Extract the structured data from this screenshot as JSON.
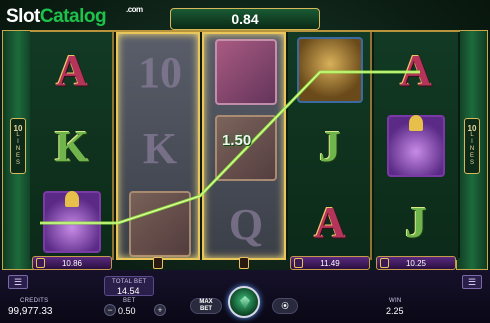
{
  "watermark": {
    "slot": "Slot",
    "catalog": "Catalog",
    "com": ".com"
  },
  "top_win": "0.84",
  "lines_badge": {
    "number": "10",
    "letters": [
      "L",
      "I",
      "N",
      "E",
      "S"
    ]
  },
  "line_win_amount": "1.50",
  "reels": [
    {
      "state": "normal",
      "symbols": [
        "A",
        "K",
        "potion"
      ]
    },
    {
      "state": "held",
      "symbols": [
        "10",
        "K",
        "book"
      ]
    },
    {
      "state": "held",
      "symbols": [
        "pink-book",
        "book",
        "Q"
      ]
    },
    {
      "state": "normal",
      "symbols": [
        "lion",
        "J",
        "A"
      ]
    },
    {
      "state": "normal",
      "symbols": [
        "A",
        "potion",
        "J"
      ]
    }
  ],
  "reel_values": [
    "10.86",
    "",
    "",
    "11.49",
    "10.25"
  ],
  "bottom_bar": {
    "credits_label": "CREDITS",
    "credits_value": "99,977.33",
    "total_bet_label": "TOTAL BET",
    "total_bet_value": "14.54",
    "bet_label": "BET",
    "bet_value": "0.50",
    "minus": "−",
    "plus": "+",
    "max_bet_line1": "MAX",
    "max_bet_line2": "BET",
    "autoplay_icon": "⦿",
    "win_label": "WIN",
    "win_value": "2.25"
  },
  "icons": [
    "lock-icon",
    "menu-icon",
    "spin-gem-icon",
    "autoplay-icon"
  ],
  "colors": {
    "accent_gold": "#d9b85a",
    "win_line": "#8fe83a",
    "spin_green": "#3fbf7a"
  }
}
